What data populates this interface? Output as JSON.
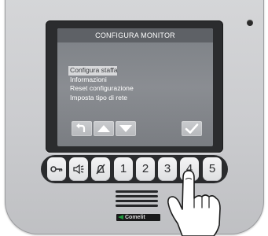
{
  "monitor": {
    "title": "CONFIGURA MONITOR",
    "menu_items": [
      {
        "label": "Configura staffa",
        "selected": true
      },
      {
        "label": "Informazioni",
        "selected": false
      },
      {
        "label": "Reset configurazione",
        "selected": false
      },
      {
        "label": "Imposta tipo di rete",
        "selected": false
      }
    ],
    "softkeys": [
      {
        "icon": "back-arrow-icon"
      },
      {
        "icon": "up-arrow-icon"
      },
      {
        "icon": "down-arrow-icon"
      },
      {
        "icon": "confirm-check-icon"
      }
    ]
  },
  "keypad": {
    "keys": [
      {
        "icon": "key-lock-icon"
      },
      {
        "icon": "speaker-volume-icon"
      },
      {
        "icon": "mute-bell-icon"
      },
      {
        "label": "1"
      },
      {
        "label": "2"
      },
      {
        "label": "3"
      },
      {
        "label": "4"
      },
      {
        "label": "5"
      }
    ],
    "pressed_key": "4"
  },
  "brand": {
    "name": "Comelit"
  },
  "colors": {
    "device_body": "#cbcccf",
    "bezel": "#2b2c2e",
    "screen": "#84878c",
    "title_bar": "#5e6166",
    "selected_highlight": "#d7d8da",
    "keypad_strip": "#2a2b2d",
    "key_face": "#ececed",
    "brand_green": "#1f9a3e"
  }
}
